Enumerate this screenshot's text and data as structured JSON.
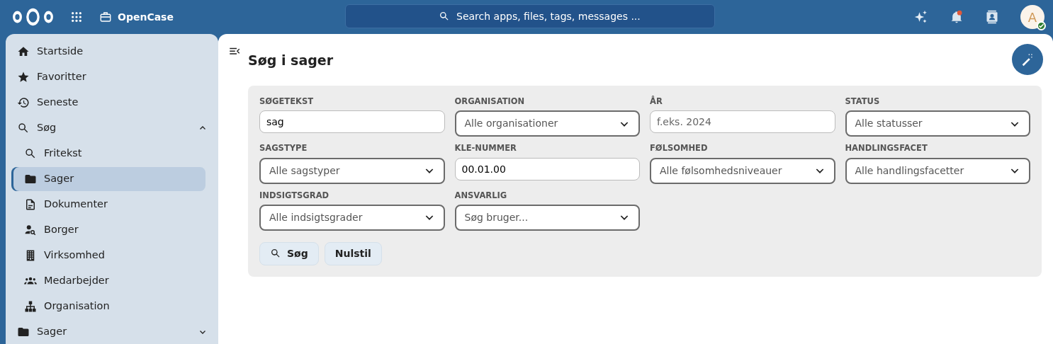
{
  "header": {
    "app_name": "OpenCase",
    "search": {
      "placeholder": "Search apps, files, tags, messages ..."
    },
    "notification_unread": true,
    "avatar": {
      "initial": "A",
      "online": true
    }
  },
  "sidebar": {
    "items": [
      {
        "label": "Startside",
        "selected": false
      },
      {
        "label": "Favoritter",
        "selected": false
      },
      {
        "label": "Seneste",
        "selected": false
      },
      {
        "label": "Søg",
        "selected": false,
        "expanded": true,
        "children": [
          {
            "label": "Fritekst",
            "selected": false
          },
          {
            "label": "Sager",
            "selected": true
          },
          {
            "label": "Dokumenter",
            "selected": false
          },
          {
            "label": "Borger",
            "selected": false
          },
          {
            "label": "Virksomhed",
            "selected": false
          },
          {
            "label": "Medarbejder",
            "selected": false
          },
          {
            "label": "Organisation",
            "selected": false
          }
        ]
      },
      {
        "label": "Sager",
        "selected": false,
        "expanded": false
      }
    ]
  },
  "page": {
    "title": "Søg i sager",
    "fields": [
      {
        "label": "SØGETEKST",
        "kind": "text",
        "value": "sag"
      },
      {
        "label": "ORGANISATION",
        "kind": "select",
        "value": "Alle organisationer"
      },
      {
        "label": "ÅR",
        "kind": "text",
        "placeholder": "f.eks. 2024"
      },
      {
        "label": "STATUS",
        "kind": "select",
        "value": "Alle statusser"
      },
      {
        "label": "SAGSTYPE",
        "kind": "select",
        "value": "Alle sagstyper"
      },
      {
        "label": "KLE-NUMMER",
        "kind": "text",
        "value": "00.01.00"
      },
      {
        "label": "FØLSOMHED",
        "kind": "select",
        "value": "Alle følsomhedsniveauer"
      },
      {
        "label": "HANDLINGSFACET",
        "kind": "select",
        "value": "Alle handlingsfacetter"
      },
      {
        "label": "INDSIGTSGRAD",
        "kind": "select",
        "value": "Alle indsigtsgrader"
      },
      {
        "label": "ANSVARLIG",
        "kind": "select",
        "value": "Søg bruger..."
      }
    ],
    "buttons": [
      {
        "label": "Søg",
        "kind": "search"
      },
      {
        "label": "Nulstil",
        "kind": "plain"
      }
    ]
  }
}
